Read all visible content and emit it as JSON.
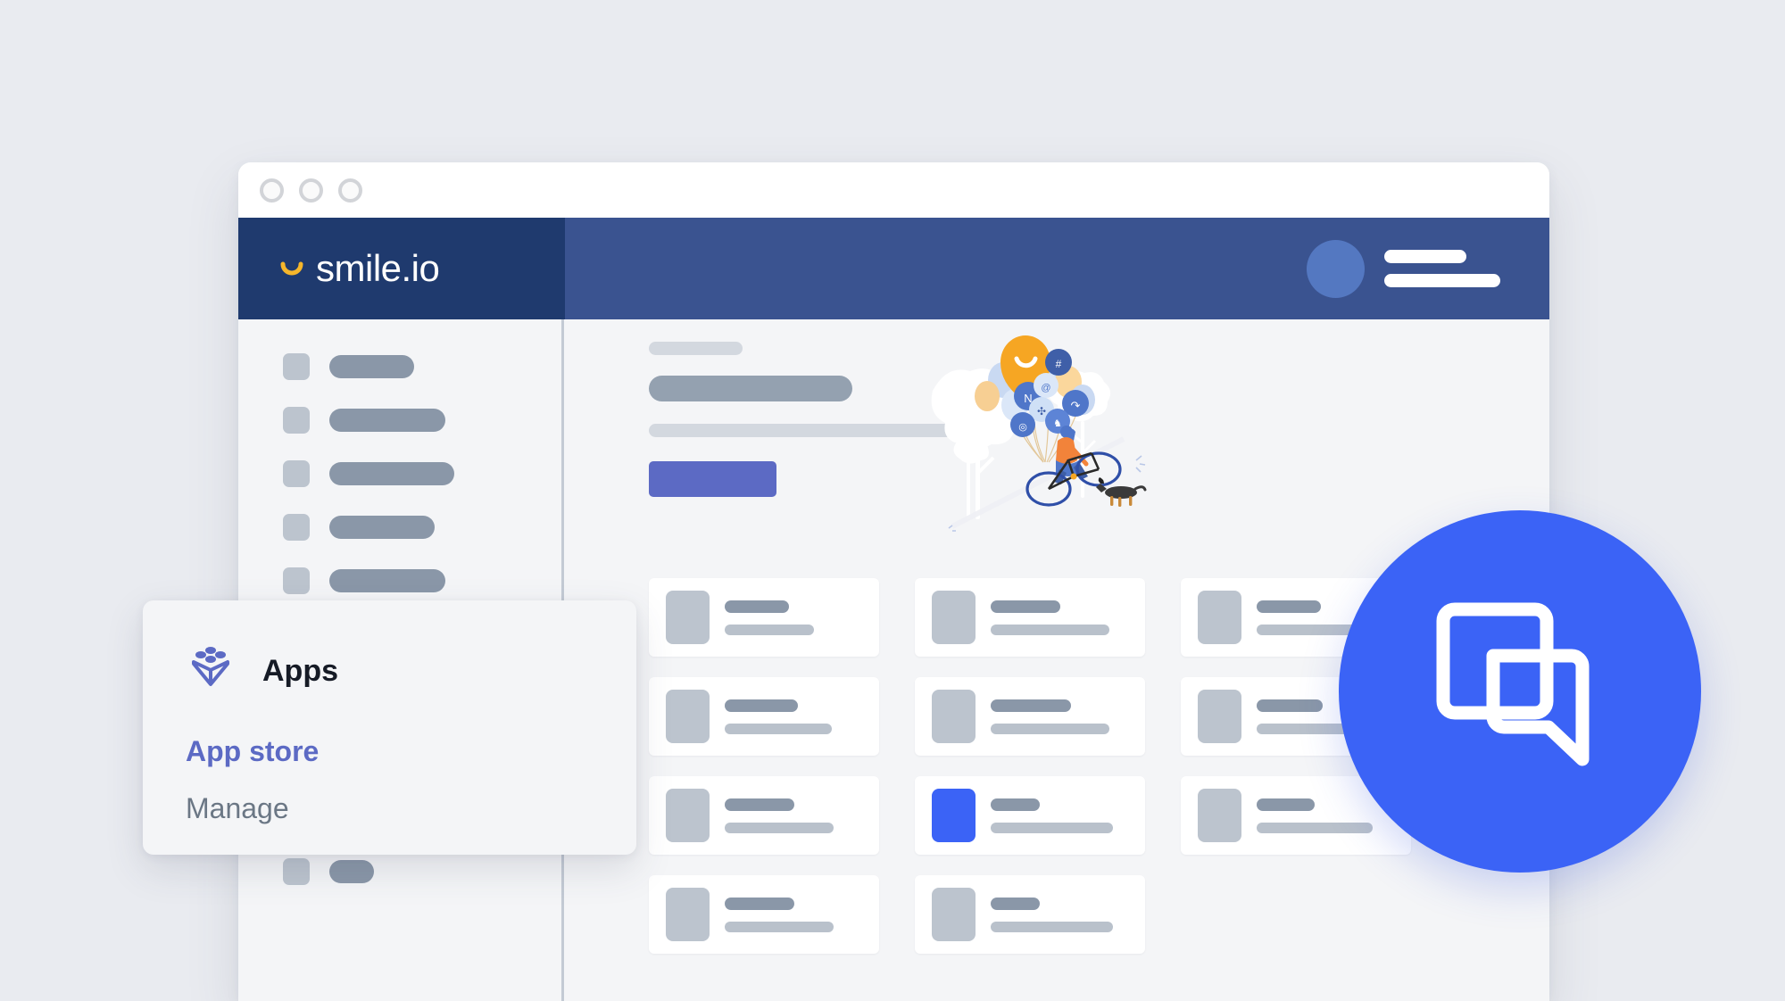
{
  "page": {
    "background_color": "#e9ebf0"
  },
  "browser_window": {
    "traffic_lights": [
      "close-dot",
      "minimize-dot",
      "maximize-dot"
    ]
  },
  "navbar": {
    "brand_name": "smile.io",
    "brand_icon": "smile-arc-icon",
    "brand_bg_color": "#1f3a6e",
    "bar_bg_color": "#3a5390",
    "smile_color": "#f5b62b",
    "avatar_icon": "avatar-circle",
    "menu_icon": "hamburger-menu-icon",
    "placeholder_bars": 2
  },
  "sidebar": {
    "items": [
      {
        "label_width": 95
      },
      {
        "label_width": 130
      },
      {
        "label_width": 140
      },
      {
        "label_width": 118
      },
      {
        "label_width": 130
      }
    ],
    "lower_item": {
      "label_width": 50
    }
  },
  "main": {
    "hero": {
      "eyebrow": "placeholder-eyebrow-bar",
      "title": "placeholder-title-bar",
      "subtitle": "placeholder-subtitle-bar",
      "button": "placeholder-primary-button",
      "button_color": "#5c6ac4"
    },
    "illustration": {
      "name": "cyclist-with-balloons-illustration",
      "elements": [
        "balloon-bunch",
        "smile-balloon",
        "app-logo-balloons",
        "cyclist",
        "bicycle",
        "dog",
        "trees"
      ],
      "smile_balloon_color": "#f9a825",
      "blue_balloon_color": "#4a6fc8"
    },
    "cards": {
      "accent_color": "#3b63f6",
      "items": [
        {
          "title_width": 72,
          "sub_width": 100,
          "accent": false
        },
        {
          "title_width": 78,
          "sub_width": 133,
          "accent": false
        },
        {
          "title_width": 72,
          "sub_width": 120,
          "accent": false
        },
        {
          "title_width": 82,
          "sub_width": 120,
          "accent": false
        },
        {
          "title_width": 90,
          "sub_width": 133,
          "accent": false
        },
        {
          "title_width": 74,
          "sub_width": 110,
          "accent": false
        },
        {
          "title_width": 78,
          "sub_width": 122,
          "accent": false
        },
        {
          "title_width": 55,
          "sub_width": 137,
          "accent": true
        },
        {
          "title_width": 65,
          "sub_width": 130,
          "accent": false
        },
        {
          "title_width": 78,
          "sub_width": 122,
          "accent": false
        },
        {
          "title_width": 55,
          "sub_width": 137,
          "accent": false
        }
      ]
    }
  },
  "apps_panel": {
    "icon": "apps-box-icon",
    "icon_color": "#5c6ac4",
    "title": "Apps",
    "links": [
      {
        "label": "App store",
        "active": true
      },
      {
        "label": "Manage",
        "active": false
      }
    ],
    "active_color": "#5c6ac4",
    "inactive_color": "#6b7785"
  },
  "floating_badge": {
    "icon": "chat-window-overlap-icon",
    "background_color": "#3b63f6",
    "icon_color": "#ffffff"
  }
}
